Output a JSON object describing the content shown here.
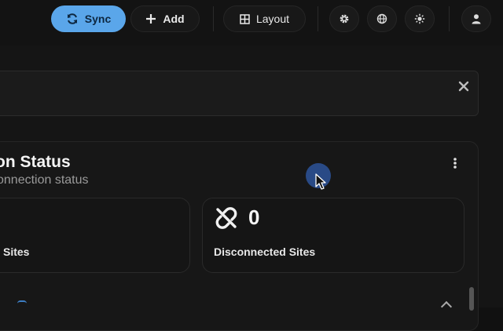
{
  "toolbar": {
    "sync_label": "Sync",
    "add_label": "Add",
    "layout_label": "Layout",
    "icons": [
      "sync-icon",
      "plus-icon",
      "layout-grid-icon",
      "gear-icon",
      "globe-icon",
      "sun-icon",
      "user-icon"
    ],
    "sync_color": "#5aa6ea"
  },
  "card": {
    "title": "on Status",
    "subtitle": "onnection status",
    "stats": [
      {
        "label": "Sites"
      },
      {
        "label": "Disconnected Sites",
        "value": "0",
        "icon": "unlink-icon"
      }
    ]
  }
}
